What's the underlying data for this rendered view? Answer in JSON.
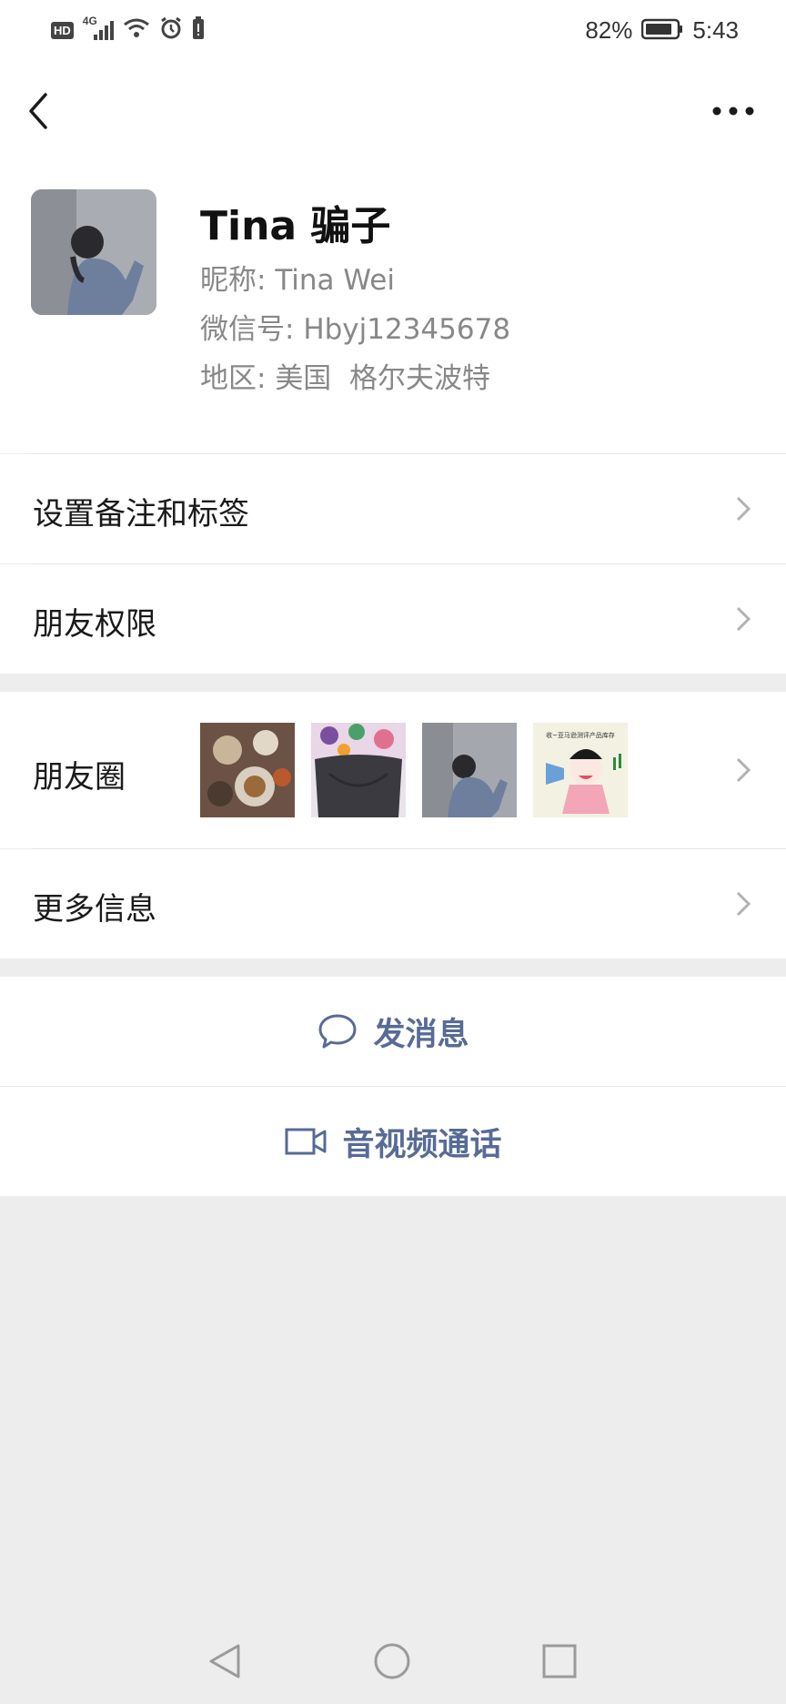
{
  "status_bar": {
    "network_badge": "HD",
    "network_type": "4G",
    "battery_percent": "82%",
    "time": "5:43"
  },
  "profile": {
    "name": "Tina 骗子",
    "nickname_label": "昵称:",
    "nickname": "Tina Wei",
    "wechat_id_label": "微信号:",
    "wechat_id": "Hbyj12345678",
    "region_label": "地区:",
    "region": "美国  格尔夫波特"
  },
  "rows": {
    "remark_tags": "设置备注和标签",
    "friend_permissions": "朋友权限",
    "moments": "朋友圈",
    "more_info": "更多信息"
  },
  "moments_thumb_caption": "收~亚马逊测评产品库存",
  "actions": {
    "send_message": "发消息",
    "video_call": "音视频通话"
  },
  "colors": {
    "link_blue": "#576b95",
    "background_gray": "#ededed"
  },
  "icons": [
    "back-arrow-icon",
    "more-dots-icon",
    "chevron-right-icon",
    "chat-bubble-icon",
    "video-camera-icon",
    "nav-back-icon",
    "nav-home-icon",
    "nav-recents-icon"
  ]
}
